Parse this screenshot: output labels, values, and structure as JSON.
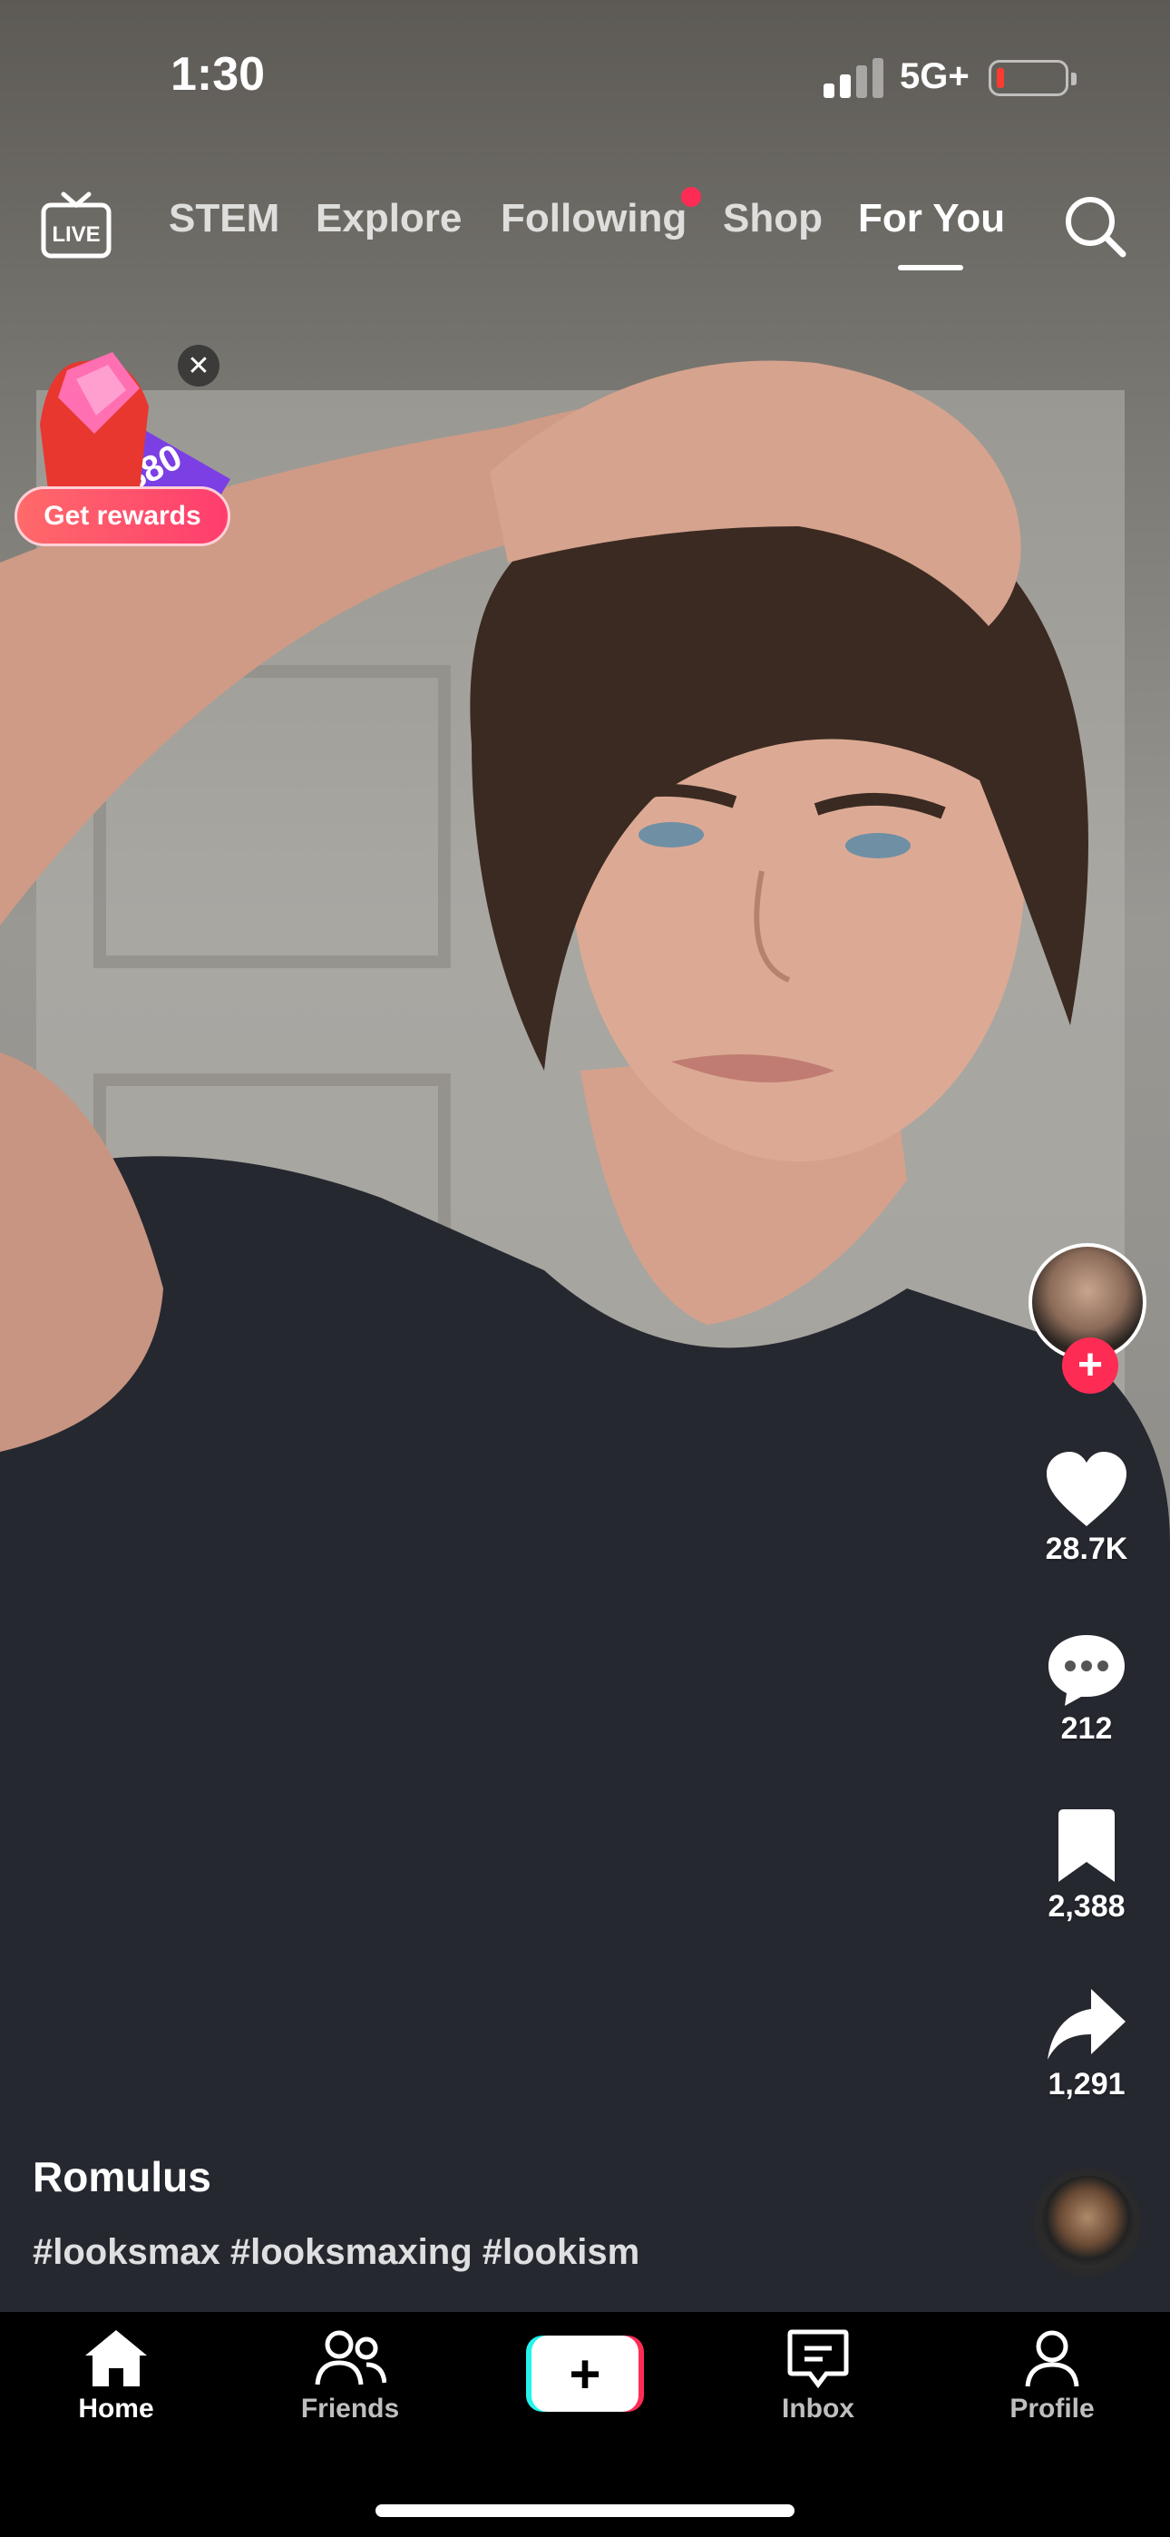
{
  "status_bar": {
    "time": "1:30",
    "network": "5G+"
  },
  "top_nav": {
    "tabs": [
      {
        "label": "STEM"
      },
      {
        "label": "Explore"
      },
      {
        "label": "Following"
      },
      {
        "label": "Shop"
      },
      {
        "label": "For You"
      }
    ],
    "active_tab": "For You",
    "live_icon": "live-tv-icon",
    "search_icon": "search-icon"
  },
  "rewards_badge": {
    "amount": "$80",
    "button_label": "Get rewards",
    "close_symbol": "✕"
  },
  "post": {
    "author": "Romulus",
    "caption": "#looksmax #looksmaxing #lookism",
    "likes": "28.7K",
    "comments": "212",
    "saves": "2,388",
    "shares": "1,291"
  },
  "bottom_nav": {
    "items": [
      {
        "label": "Home",
        "icon": "home-icon"
      },
      {
        "label": "Friends",
        "icon": "friends-icon"
      },
      {
        "label": "",
        "icon": "create-plus-icon"
      },
      {
        "label": "Inbox",
        "icon": "inbox-icon"
      },
      {
        "label": "Profile",
        "icon": "profile-icon"
      }
    ],
    "active": "Home"
  },
  "colors": {
    "accent": "#fe2c55",
    "cyan": "#25f4ee",
    "background": "#000000"
  }
}
